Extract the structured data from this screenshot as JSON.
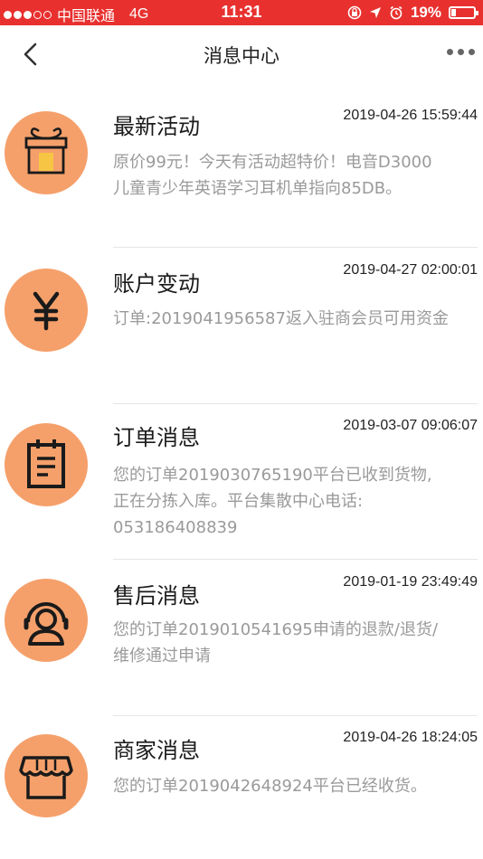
{
  "status_bar": {
    "carrier": "中国联通",
    "network": "4G",
    "time": "11:31",
    "battery": "19%"
  },
  "nav": {
    "title": "消息中心"
  },
  "colors": {
    "status_bar": "#e8312f",
    "icon_bg": "#f5a06b",
    "icon_stroke": "#1a1a1a",
    "gift_accent": "#f7c544"
  },
  "items": [
    {
      "icon": "gift-icon",
      "title": "最新活动",
      "time": "2019-04-26 15:59:44",
      "lines": [
        "原价99元！今天有活动超特价！电音D3000",
        "儿童青少年英语学习耳机单指向85DB。"
      ]
    },
    {
      "icon": "yuan-icon",
      "title": "账户变动",
      "time": "2019-04-27 02:00:01",
      "lines": [
        "订单:2019041956587返入驻商会员可用资金"
      ]
    },
    {
      "icon": "clipboard-icon",
      "title": "订单消息",
      "time": "2019-03-07 09:06:07",
      "lines": [
        "您的订单2019030765190平台已收到货物,",
        "正在分拣入库。平台集散中心电话:",
        "053186408839"
      ]
    },
    {
      "icon": "headset-icon",
      "title": "售后消息",
      "time": "2019-01-19 23:49:49",
      "lines": [
        "您的订单2019010541695申请的退款/退货/",
        "维修通过申请"
      ]
    },
    {
      "icon": "shop-icon",
      "title": "商家消息",
      "time": "2019-04-26 18:24:05",
      "lines": [
        "您的订单2019042648924平台已经收货。"
      ]
    }
  ]
}
